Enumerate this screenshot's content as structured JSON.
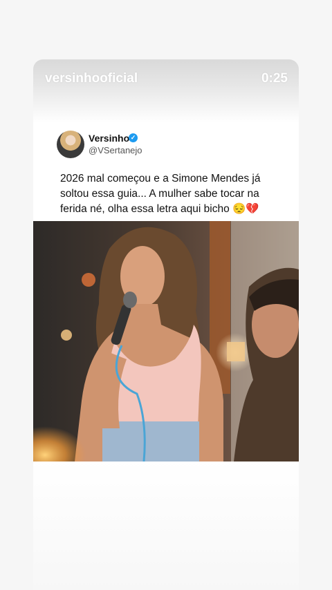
{
  "story": {
    "account": "versinhooficial",
    "timer": "0:25"
  },
  "post": {
    "display_name": "Versinho",
    "verified_glyph": "✓",
    "handle": "@VSertanejo",
    "text": "2026 mal começou e a Simone Mendes já soltou essa guia... A mulher sabe tocar na ferida né, olha essa letra aqui bicho 😔💔"
  },
  "icons": {
    "verified": "verified-badge-icon",
    "avatar": "profile-avatar"
  },
  "colors": {
    "verified": "#1d9bf0",
    "card": "#ffffff",
    "page": "#f6f6f6"
  }
}
